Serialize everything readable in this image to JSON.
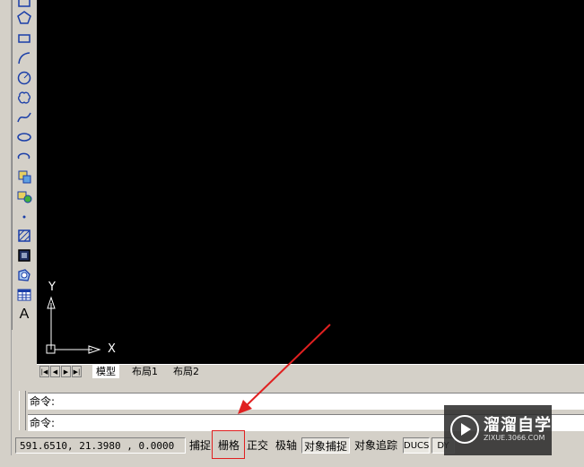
{
  "toolbar": {
    "tools": [
      {
        "icon": "rectangle-small-icon"
      },
      {
        "icon": "polygon-icon"
      },
      {
        "icon": "rectangle-icon"
      },
      {
        "icon": "arc-icon"
      },
      {
        "icon": "circle-icon"
      },
      {
        "icon": "revision-cloud-icon"
      },
      {
        "icon": "spline-icon"
      },
      {
        "icon": "ellipse-icon"
      },
      {
        "icon": "ellipse-arc-icon"
      },
      {
        "icon": "insert-block-icon"
      },
      {
        "icon": "make-block-icon"
      },
      {
        "icon": "point-icon"
      },
      {
        "icon": "hatch-icon"
      },
      {
        "icon": "gradient-icon"
      },
      {
        "icon": "region-icon"
      },
      {
        "icon": "table-icon"
      },
      {
        "icon": "multiline-text-icon",
        "label": "A"
      }
    ]
  },
  "ucs": {
    "x_label": "X",
    "y_label": "Y"
  },
  "tabs": {
    "items": [
      {
        "label": "模型",
        "active": true
      },
      {
        "label": "布局1",
        "active": false
      },
      {
        "label": "布局2",
        "active": false
      }
    ]
  },
  "command": {
    "line1": "命令:",
    "line2": "命令:"
  },
  "status": {
    "coordinates": "591.6510,  21.3980 , 0.0000",
    "buttons": [
      {
        "label": "捕捉",
        "pressed": false
      },
      {
        "label": "栅格",
        "pressed": false
      },
      {
        "label": "正交",
        "pressed": false
      },
      {
        "label": "极轴",
        "pressed": false
      },
      {
        "label": "对象捕捉",
        "pressed": true
      },
      {
        "label": "对象追踪",
        "pressed": false
      },
      {
        "label": "DUCS",
        "pressed": true
      },
      {
        "label": "DY",
        "pressed": true
      }
    ]
  },
  "watermark": {
    "brand": "溜溜自学",
    "url": "ZIXUE.3066.COM"
  },
  "colors": {
    "canvas": "#000000",
    "chrome": "#d4d0c8",
    "annotation": "#e02020"
  }
}
